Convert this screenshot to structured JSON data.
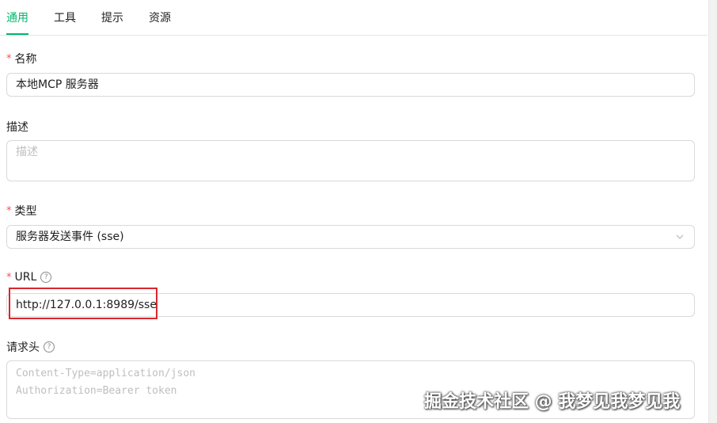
{
  "tabs": [
    {
      "label": "通用",
      "active": true
    },
    {
      "label": "工具",
      "active": false
    },
    {
      "label": "提示",
      "active": false
    },
    {
      "label": "资源",
      "active": false
    }
  ],
  "form": {
    "name": {
      "label": "名称",
      "required_mark": "*",
      "value": "本地MCP 服务器"
    },
    "description": {
      "label": "描述",
      "placeholder": "描述"
    },
    "type": {
      "label": "类型",
      "required_mark": "*",
      "value": "服务器发送事件 (sse)"
    },
    "url": {
      "label": "URL",
      "required_mark": "*",
      "help": "?",
      "value": "http://127.0.0.1:8989/sse"
    },
    "headers": {
      "label": "请求头",
      "help": "?",
      "placeholder_lines": [
        "Content-Type=application/json",
        "Authorization=Bearer token"
      ]
    }
  },
  "watermark": "掘金技术社区 @ 我梦见我梦见我",
  "colors": {
    "accent": "#00b96b",
    "required": "#ff4d4f",
    "highlight": "#d9272e",
    "border": "#d9d9d9"
  }
}
